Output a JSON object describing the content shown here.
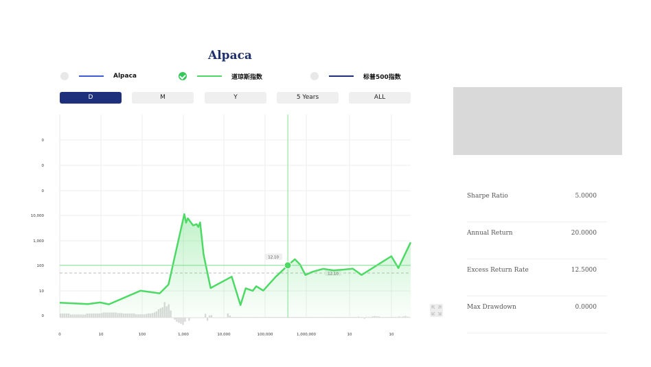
{
  "title": "Alpaca",
  "legend": [
    {
      "label": "Alpaca",
      "checked": false,
      "color": "#3b5bdb"
    },
    {
      "label": "道琼斯指数",
      "checked": true,
      "color": "#4cd964"
    },
    {
      "label": "标普500指数",
      "checked": false,
      "color": "#1e2f7c"
    }
  ],
  "tabs": [
    {
      "label": "D",
      "active": true
    },
    {
      "label": "M",
      "active": false
    },
    {
      "label": "Y",
      "active": false
    },
    {
      "label": "5 Years",
      "active": false
    },
    {
      "label": "ALL",
      "active": false
    }
  ],
  "stats": [
    {
      "label": "Sharpe Ratio",
      "value": "5.0000"
    },
    {
      "label": "Annual Return",
      "value": "20.0000"
    },
    {
      "label": "Excess Return Rate",
      "value": "12.5000"
    },
    {
      "label": "Max Drawdown",
      "value": "0.0000"
    }
  ],
  "colors": {
    "accent": "#1e2f7c",
    "line": "#4cd964",
    "title": "#1e2f6b"
  },
  "icons": {
    "expand": "expand-icon"
  },
  "chart_data": {
    "type": "line",
    "series": [
      {
        "name": "道琼斯指数",
        "values": [
          [
            0,
            0.51
          ],
          [
            0.08,
            0.455
          ],
          [
            0.115,
            0.52
          ],
          [
            0.14,
            0.445
          ],
          [
            0.23,
            0.985
          ],
          [
            0.285,
            0.88
          ],
          [
            0.31,
            1.23
          ],
          [
            0.355,
            4.02
          ],
          [
            0.36,
            3.68
          ],
          [
            0.365,
            3.85
          ],
          [
            0.38,
            3.57
          ],
          [
            0.39,
            3.62
          ],
          [
            0.395,
            3.51
          ],
          [
            0.4,
            3.69
          ],
          [
            0.41,
            2.41
          ],
          [
            0.43,
            1.09
          ],
          [
            0.49,
            1.54
          ],
          [
            0.515,
            0.415
          ],
          [
            0.53,
            1.08
          ],
          [
            0.55,
            0.98
          ],
          [
            0.56,
            1.16
          ],
          [
            0.58,
            0.99
          ],
          [
            0.615,
            1.53
          ],
          [
            0.65,
            1.99
          ],
          [
            0.67,
            2.23
          ],
          [
            0.685,
            2.02
          ],
          [
            0.7,
            1.61
          ],
          [
            0.72,
            1.73
          ],
          [
            0.75,
            1.85
          ],
          [
            0.78,
            1.79
          ],
          [
            0.81,
            1.82
          ],
          [
            0.835,
            1.86
          ],
          [
            0.86,
            1.61
          ],
          [
            0.945,
            2.35
          ],
          [
            0.965,
            1.88
          ],
          [
            1,
            2.9
          ]
        ]
      }
    ],
    "x_ticks": [
      "0",
      "10",
      "100",
      "1,000",
      "10,000",
      "100,000",
      "1,000,000",
      "10",
      "10"
    ],
    "y_ticks": [
      "0",
      "10",
      "100",
      "1,000",
      "10,000",
      "0",
      "0",
      "0"
    ],
    "crosshair": {
      "x": 0.65,
      "y_label": "12.10",
      "x_label": "12.10"
    },
    "reference_line": {
      "label": "12.10"
    },
    "volume": [
      2,
      2,
      2,
      2,
      2,
      1.5,
      1.5,
      1.5,
      1.5,
      1.5,
      1.5,
      1.5,
      1.5,
      2,
      2,
      2,
      2,
      2,
      2,
      2,
      2.2,
      2.5,
      2.5,
      2.5,
      2.5,
      2.5,
      2.5,
      2.5,
      2.2,
      2.2,
      2.2,
      2,
      2,
      2,
      2,
      2,
      2,
      1.6,
      1.6,
      1.6,
      1.6,
      1.6,
      1.8,
      2,
      2,
      2.2,
      2.5,
      3,
      4,
      4.5,
      5,
      7.5,
      5.5,
      6.5,
      3.5,
      0,
      -1,
      -2,
      -2.5,
      -3,
      -3.5,
      -2,
      0,
      -1.5,
      0,
      0,
      0,
      0,
      0,
      0,
      0,
      1.8,
      -1.5,
      1,
      1.2,
      0,
      0,
      0,
      0,
      0,
      0,
      0,
      2,
      1,
      0.3,
      0.3,
      0.3,
      0.3,
      0.3,
      0.3,
      0.3,
      0.3,
      0.3,
      0.3,
      0.3,
      0.3,
      0.3,
      0.3,
      0.3,
      0.3,
      0.3,
      0.3,
      0.3,
      0.3,
      0.3,
      0.3,
      0.3,
      0.3,
      0.3,
      0.3,
      0.3,
      0.3,
      0.3,
      0.3,
      0.3,
      0.3,
      0.3,
      0.3,
      0.3,
      0.3,
      0.3,
      0.3,
      0.3,
      0.3,
      0.3,
      0.3,
      0.3,
      0.3,
      0.3,
      0.3,
      0.3,
      0.3,
      0.3,
      0.3,
      0.3,
      0.3,
      0.3,
      0.3,
      0.3,
      0.3,
      0.3,
      0.3,
      0.3,
      0.3,
      0.3,
      0.3,
      0.5,
      0.3,
      0.3,
      -0.5,
      0.3,
      0.3,
      0.3,
      0.6,
      0.8,
      0.6,
      0.6,
      0.3,
      0.3,
      0.3,
      0.3,
      0.3,
      0.3,
      0.3,
      0.3,
      0.3,
      0.6,
      0.3,
      0.6,
      0.8,
      0.5,
      0.3
    ]
  }
}
